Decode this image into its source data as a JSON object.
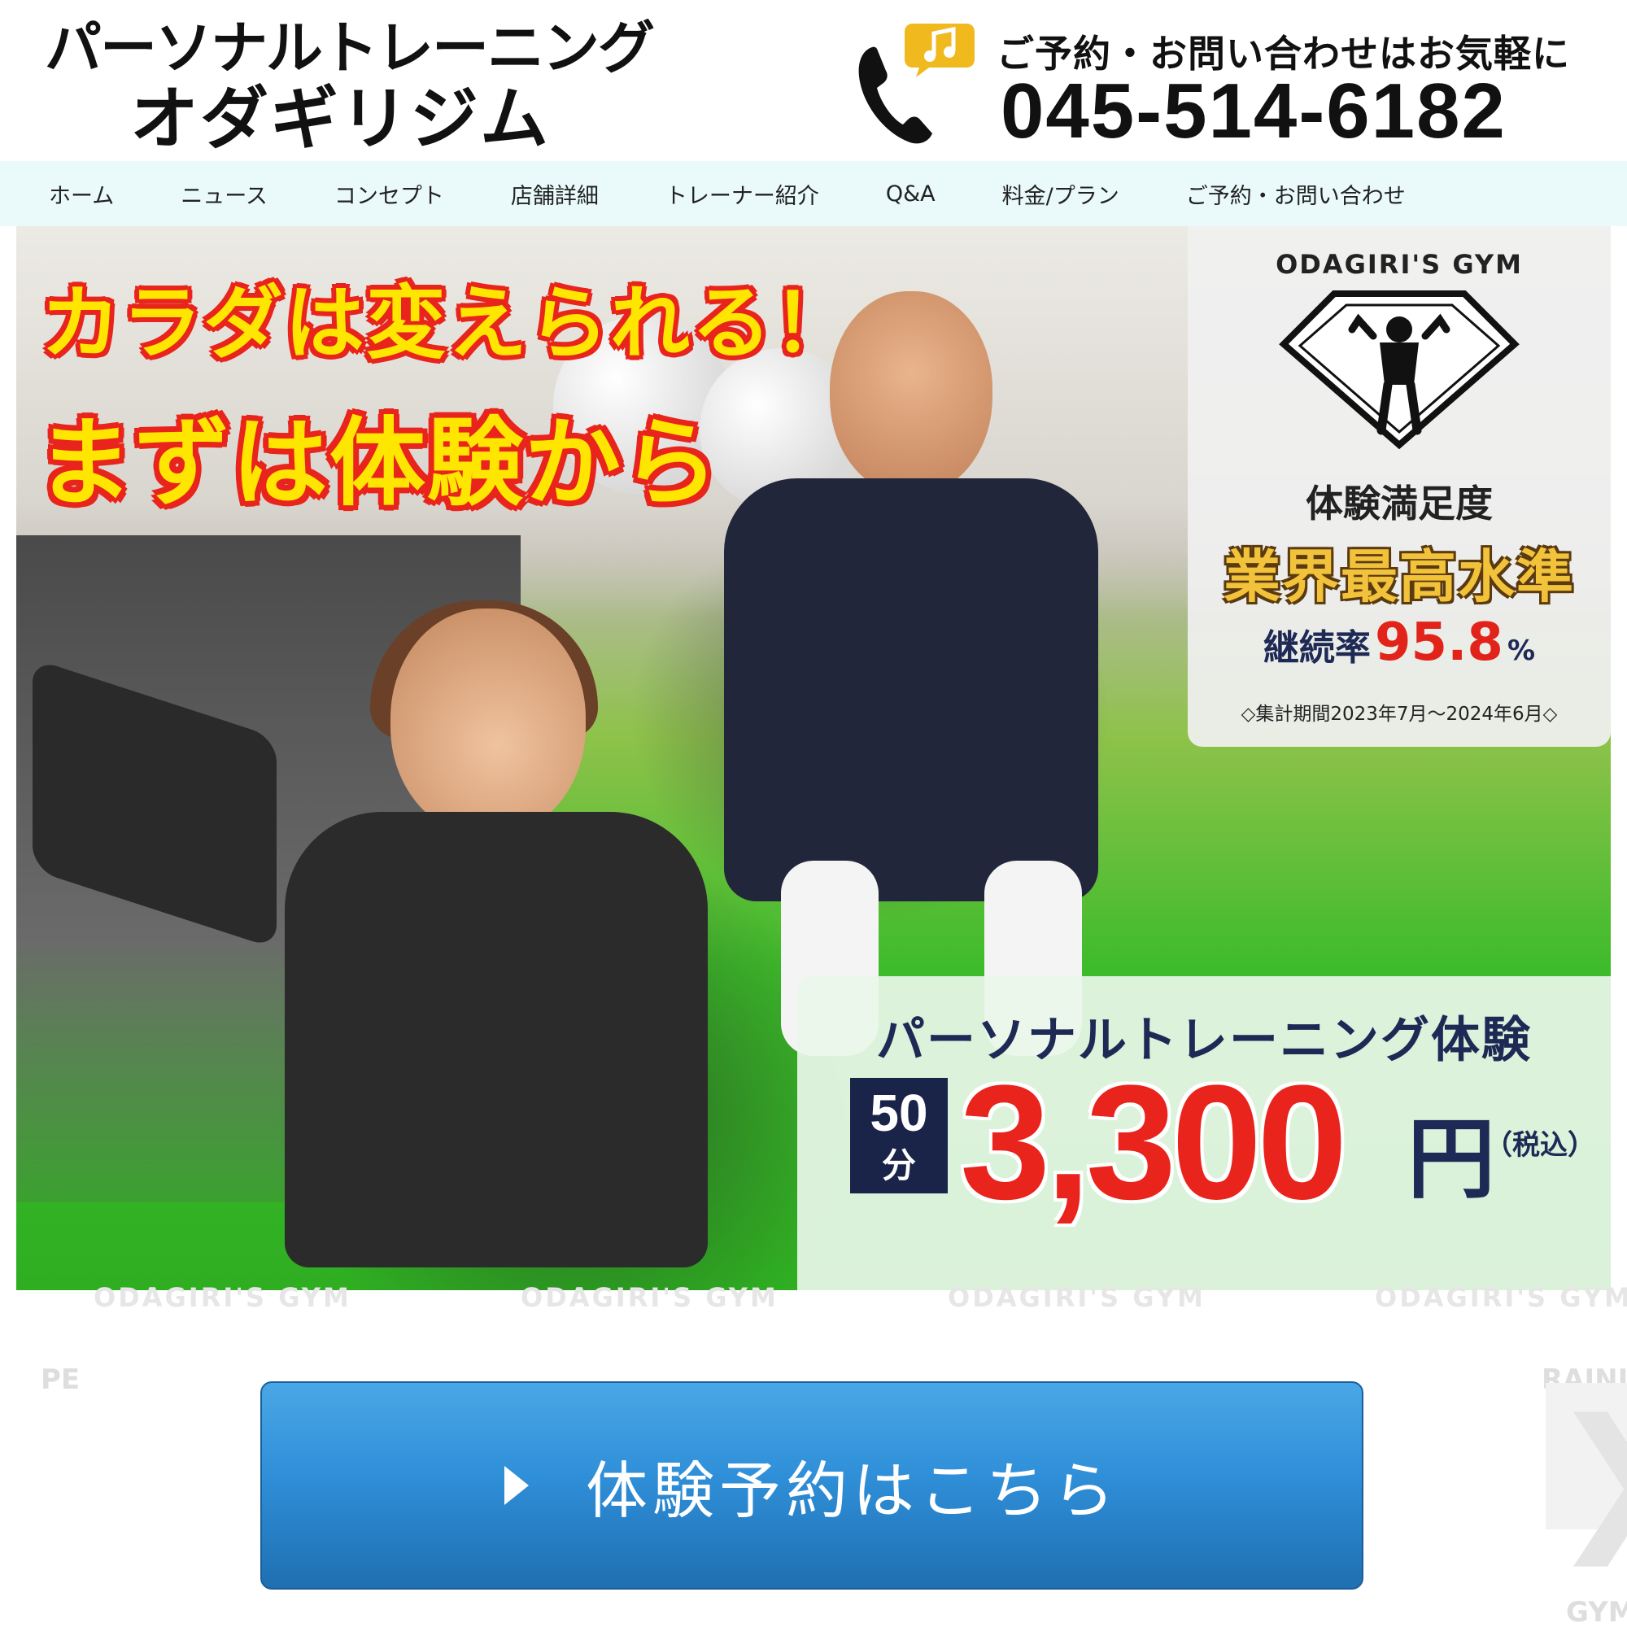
{
  "header": {
    "logo_line1": "パーソナルトレーニング",
    "logo_line2": "オダギリジム",
    "contact_tagline": "ご予約・お問い合わせはお気軽に",
    "phone": "045-514-6182"
  },
  "nav": {
    "items": [
      {
        "label": "ホーム"
      },
      {
        "label": "ニュース"
      },
      {
        "label": "コンセプト"
      },
      {
        "label": "店舗詳細"
      },
      {
        "label": "トレーナー紹介"
      },
      {
        "label": "Q&A"
      },
      {
        "label": "料金/プラン"
      },
      {
        "label": "ご予約・お問い合わせ"
      }
    ]
  },
  "hero": {
    "headline1": "カラダは変えられる！",
    "headline2": "まずは体験から",
    "badge": {
      "gym_name": "ODAGIRI'S GYM",
      "satisfaction_label": "体験満足度",
      "satisfaction_value": "業界最高水準",
      "rate_label": "継続率",
      "rate_value": "95.8",
      "rate_unit": "%",
      "period": "◇集計期間2023年7月〜2024年6月◇"
    },
    "price": {
      "title": "パーソナルトレーニング体験",
      "duration_num": "50",
      "duration_unit": "分",
      "amount": "3,300",
      "currency": "円",
      "tax_note": "（税込）"
    }
  },
  "below": {
    "watermark_text": "ODAGIRI'S GYM",
    "left_fragment": "PE",
    "right_fragment": "RAINI",
    "bottom_right_fragment": "GYM"
  },
  "cta": {
    "label": "体験予約はこちら"
  },
  "colors": {
    "nav_bg": "#eafafa",
    "headline_fill": "#ffe600",
    "headline_outline": "#e8241c",
    "price_red": "#e8241c",
    "navy": "#1e2a55",
    "cta_blue": "#2f8fd8",
    "badge_gold": "#f2c23a"
  }
}
